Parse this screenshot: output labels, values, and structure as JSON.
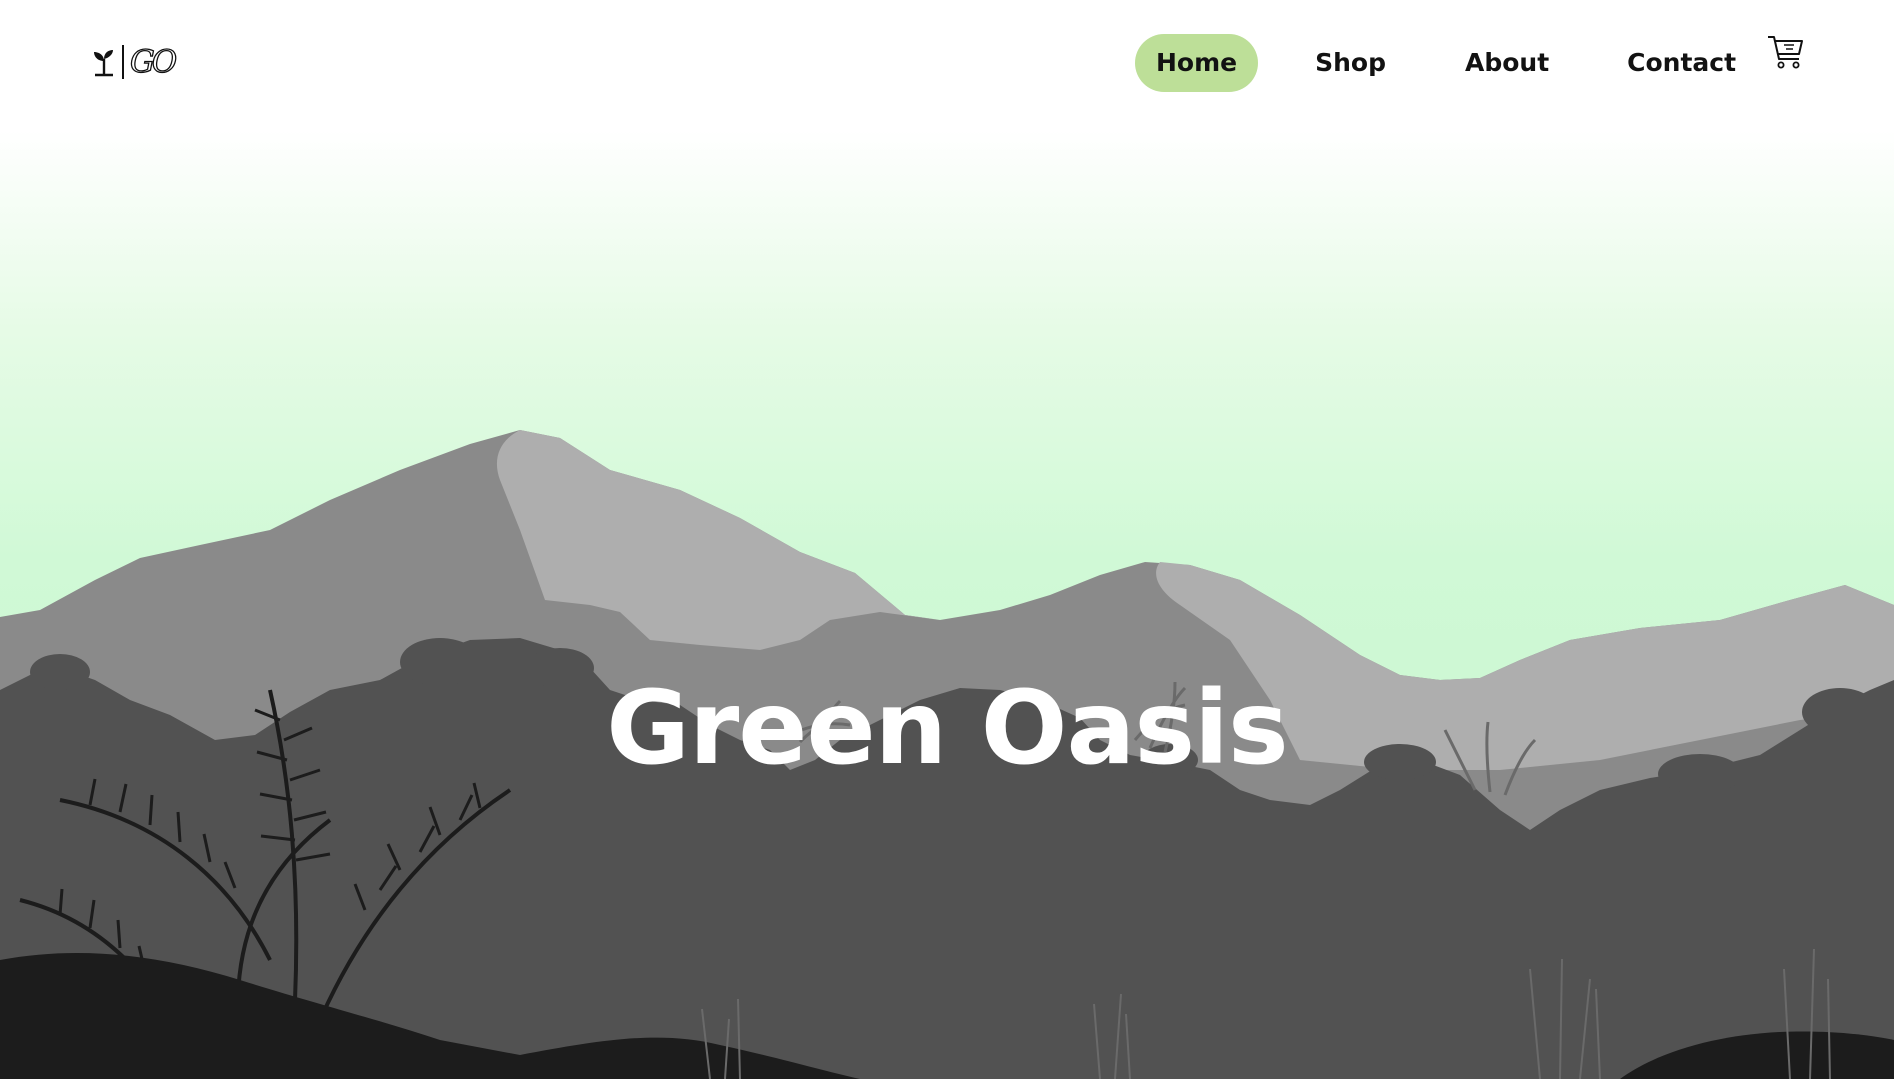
{
  "brand": {
    "logo_text": "GO"
  },
  "nav": {
    "items": [
      {
        "label": "Home",
        "active": true
      },
      {
        "label": "Shop",
        "active": false
      },
      {
        "label": "About",
        "active": false
      },
      {
        "label": "Contact",
        "active": false
      }
    ],
    "cart_icon": "shopping-cart-icon"
  },
  "hero": {
    "title": "Green Oasis"
  },
  "colors": {
    "active_pill": "#bddf98",
    "sky_top": "#ffffff",
    "sky_bottom": "#cdf8d3",
    "mountain_dark": "#8a8a8a",
    "mountain_light": "#aeaeae",
    "jungle": "#525252",
    "foreground": "#1c1c1c",
    "title_text": "#ffffff"
  }
}
